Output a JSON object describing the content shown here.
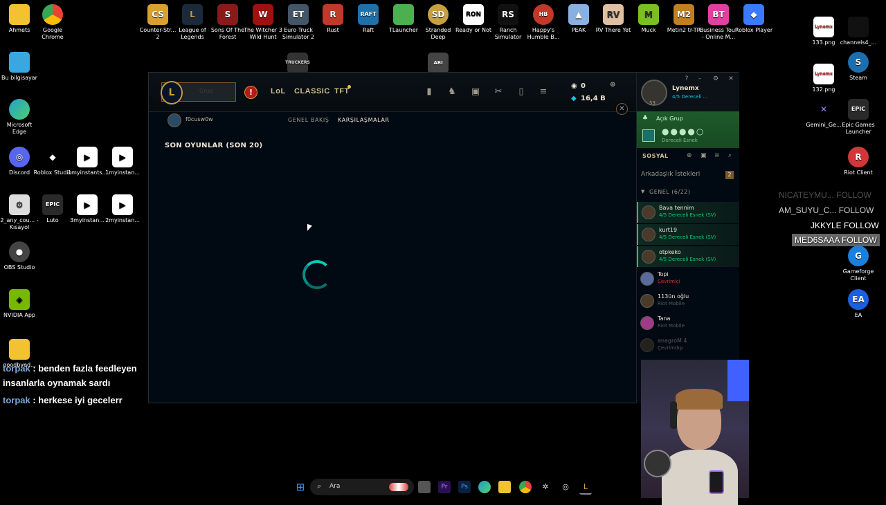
{
  "desktop_left": [
    {
      "label": "Ahmets",
      "color": "#f2c230",
      "glyph": "▬"
    },
    {
      "label": "Google Chrome",
      "color": "#ea4335",
      "glyph": "◉"
    },
    {
      "label": "Bu bilgisayar",
      "color": "#3aa8e0",
      "glyph": "▭"
    },
    {
      "label": "Microsoft Edge",
      "color": "#1fa0c8",
      "glyph": "e"
    },
    {
      "label": "Discord",
      "color": "#5865f2",
      "glyph": "◎"
    },
    {
      "label": "Roblox Studio",
      "color": "#ffffff",
      "glyph": "◆"
    },
    {
      "label": "1myinstants....",
      "color": "#ffffff",
      "glyph": "▶"
    },
    {
      "label": "1myinstan...",
      "color": "#ffffff",
      "glyph": "▶"
    },
    {
      "label": "2_any_cou... - Kısayol",
      "color": "#dddddd",
      "glyph": "⚙"
    },
    {
      "label": "Luto",
      "color": "#2a2a2a",
      "glyph": "EPIC"
    },
    {
      "label": "3myinstan...",
      "color": "#ffffff",
      "glyph": "▶"
    },
    {
      "label": "2myinstan...",
      "color": "#ffffff",
      "glyph": "▶"
    },
    {
      "label": "OBS Studio",
      "color": "#444444",
      "glyph": "●"
    },
    {
      "label": "NVIDIA App",
      "color": "#76b900",
      "glyph": "◈"
    },
    {
      "label": "goodbyed...",
      "color": "#f2c230",
      "glyph": "▬"
    }
  ],
  "desktop_top": [
    {
      "label": "Counter-Str... 2",
      "color": "#d9a030",
      "glyph": "CS"
    },
    {
      "label": "League of Legends",
      "color": "#1a2a3a",
      "glyph": "L"
    },
    {
      "label": "Sons Of The Forest",
      "color": "#8a1a1a",
      "glyph": "S"
    },
    {
      "label": "The Witcher 3 Wild Hunt",
      "color": "#a01010",
      "glyph": "W"
    },
    {
      "label": "Euro Truck Simulator 2",
      "color": "#445566",
      "glyph": "ET"
    },
    {
      "label": "Rust",
      "color": "#c0392b",
      "glyph": "R"
    },
    {
      "label": "Raft",
      "color": "#1f6fa8",
      "glyph": "RAFT"
    },
    {
      "label": "TLauncher",
      "color": "#4caf50",
      "glyph": "■"
    },
    {
      "label": "Stranded Deep",
      "color": "#c8a040",
      "glyph": "SD"
    },
    {
      "label": "Ready or Not",
      "color": "#ffffff",
      "glyph": "RON"
    },
    {
      "label": "Ranch Simulator",
      "color": "#ffffff",
      "glyph": "RS"
    },
    {
      "label": "Happy's Humble B...",
      "color": "#c0392b",
      "glyph": "HB"
    },
    {
      "label": "PEAK",
      "color": "#8ab0e0",
      "glyph": "▲"
    },
    {
      "label": "RV There Yet",
      "color": "#e0c0a0",
      "glyph": "RV"
    },
    {
      "label": "Muck",
      "color": "#7ac020",
      "glyph": "M"
    },
    {
      "label": "Metin2 tr-TR",
      "color": "#c08020",
      "glyph": "M2"
    },
    {
      "label": "Business Tour - Online M...",
      "color": "#e040a0",
      "glyph": "BT"
    },
    {
      "label": "Roblox Player",
      "color": "#3a7aff",
      "glyph": "◆"
    }
  ],
  "desktop_mid": [
    {
      "label": "",
      "glyph": "TRUCKERS"
    },
    {
      "label": "",
      "glyph": "ABI"
    }
  ],
  "desktop_right": [
    {
      "label": "133.png",
      "color": "#ffffff",
      "glyph": "Lynemx"
    },
    {
      "label": "channels4_...",
      "color": "#ffffff",
      "glyph": ""
    },
    {
      "label": "132.png",
      "color": "#ffffff",
      "glyph": "Lynemx"
    },
    {
      "label": "Steam",
      "color": "#1b6fb0",
      "glyph": "S"
    },
    {
      "label": "Gemini_Ge...",
      "color": "#000000",
      "glyph": "✕"
    },
    {
      "label": "Epic Games Launcher",
      "color": "#2a2a2a",
      "glyph": "EPIC"
    },
    {
      "label": "Riot Client",
      "color": "#d13639",
      "glyph": "R"
    },
    {
      "label": "Gameforge Client",
      "color": "#1a80e0",
      "glyph": "G"
    },
    {
      "label": "EA",
      "color": "#1a60e0",
      "glyph": "EA"
    }
  ],
  "chat": [
    {
      "user": "torpak",
      "msg": " : benden fazla feedleyen insanlarla oynamak sardı"
    },
    {
      "user": "torpak",
      "msg": " : herkese iyi gecelerr"
    }
  ],
  "overlay": {
    "line1": "NICATEYMU...  FOLLOW",
    "line2": "AM_SUYU_C...  FOLLOW",
    "line3": "JKKYLE  FOLLOW",
    "line4": "MED6SAAA  FOLLOW"
  },
  "client": {
    "play_label": "Grup",
    "nav": [
      "LoL",
      "CLASSIC",
      "TFT"
    ],
    "currency_rp": "0",
    "currency_be": "16,4 B",
    "summoner": "f0cusw0w",
    "tabs": [
      "GENEL BAKIŞ",
      "KARŞILAŞMALAR"
    ],
    "section_title": "SON OYUNLAR (SON 20)",
    "close_glyph": "✕"
  },
  "social": {
    "name": "Lynemx",
    "level": "53",
    "status": "4/5 Dereceli ...",
    "group_label": "Açık Grup",
    "group_sub": "Dereceli Esnek",
    "section_label": "SOSYAL",
    "friend_requests_label": "Arkadaşlık İstekleri",
    "friend_requests_count": "2",
    "general_label": "GENEL (6/22)",
    "friends": [
      {
        "name": "Bava tennim",
        "status": "4/5 Dereceli Esnek (SV)",
        "kind": "ingame"
      },
      {
        "name": "kurt19",
        "status": "4/5 Dereceli Esnek (SV)",
        "kind": "ingame"
      },
      {
        "name": "otpkeko",
        "status": "4/5 Dereceli Esnek (SV)",
        "kind": "ingame"
      },
      {
        "name": "Topi",
        "status": "Çevrimiçi",
        "kind": "away"
      },
      {
        "name": "113ün oğlu",
        "status": "Riot Mobile",
        "kind": "mobile"
      },
      {
        "name": "Tana",
        "status": "Riot Mobile",
        "kind": "mobile"
      },
      {
        "name": "anagroM 4",
        "status": "Çevrimdışı",
        "kind": "offline"
      }
    ]
  },
  "taskbar": {
    "search_placeholder": "Ara"
  }
}
